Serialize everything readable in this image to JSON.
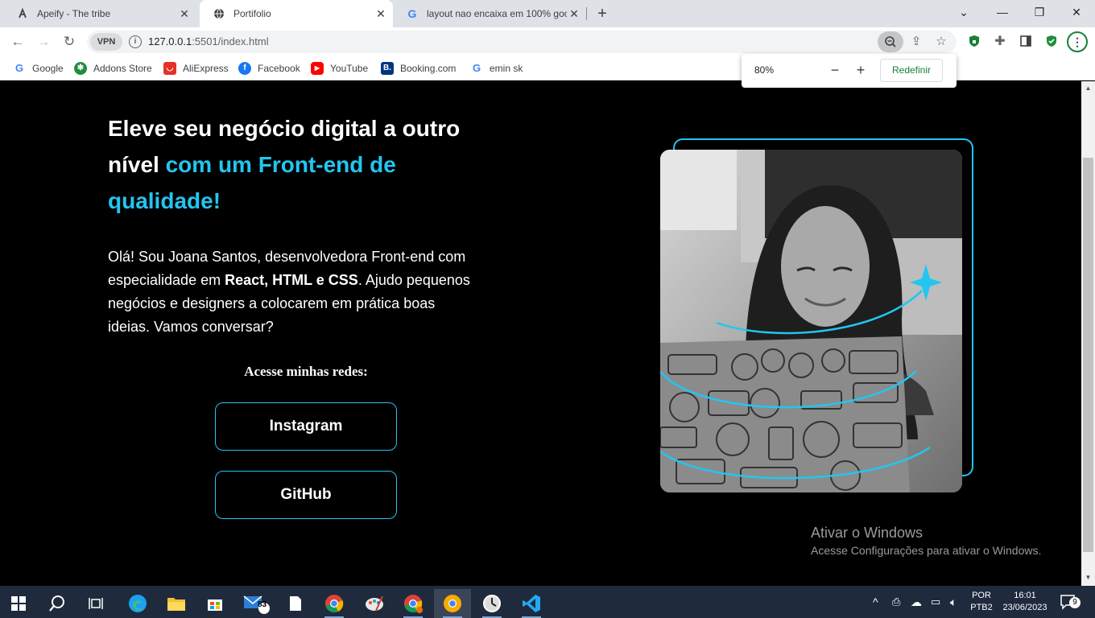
{
  "browser": {
    "tabs": [
      {
        "title": "Apeify - The tribe",
        "active": false
      },
      {
        "title": "Portifolio",
        "active": true
      },
      {
        "title": "layout nao encaixa em 100% goo",
        "active": false
      }
    ],
    "url_host": "127.0.0.1",
    "url_path": ":5501/index.html",
    "vpn_label": "VPN",
    "bookmarks": [
      "Google",
      "Addons Store",
      "AliExpress",
      "Facebook",
      "YouTube",
      "Booking.com",
      "emin sk"
    ],
    "zoom": {
      "level": "80%",
      "reset_label": "Redefinir",
      "minus": "−",
      "plus": "+"
    }
  },
  "page": {
    "headline_white": "Eleve seu negócio digital a outro nível ",
    "headline_accent": "com um Front-end de qualidade!",
    "intro_1": "Olá! Sou Joana Santos, desenvolvedora Front-end com especialidade em ",
    "intro_bold": "React, HTML e CSS",
    "intro_2": ". Ajudo pequenos negócios e designers a colocarem em prática boas ideias. Vamos conversar?",
    "social_title": "Acesse minhas redes:",
    "buttons": {
      "instagram": "Instagram",
      "github": "GitHub"
    },
    "accent_color": "#22c6f0"
  },
  "windows_activation": {
    "title": "Ativar o Windows",
    "subtitle": "Acesse Configurações para ativar o Windows."
  },
  "taskbar": {
    "mail_badge": "83",
    "lang": "POR",
    "layout": "PTB2",
    "time": "16:01",
    "date": "23/06/2023",
    "notifications": "9"
  }
}
